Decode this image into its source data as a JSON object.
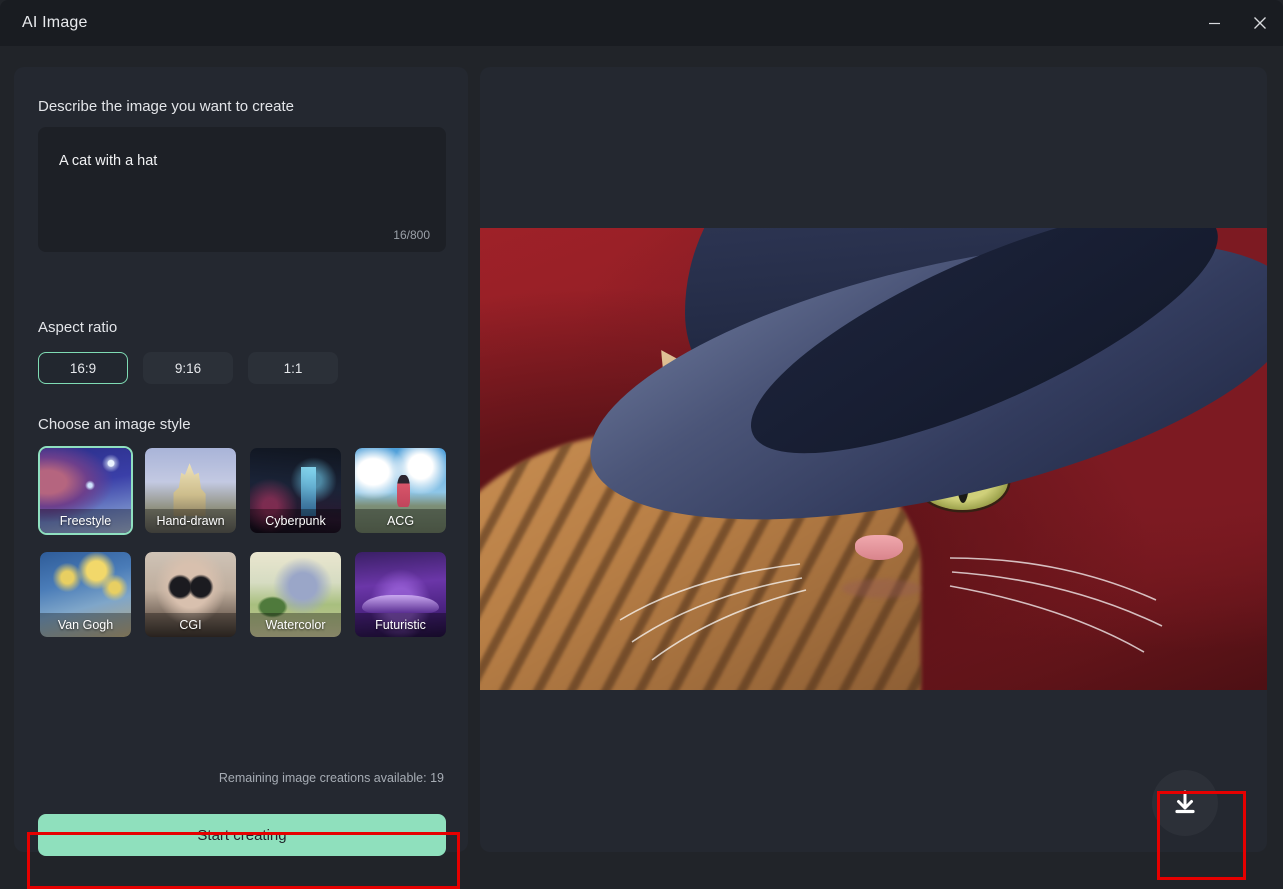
{
  "window": {
    "title": "AI Image",
    "controls": [
      {
        "name": "minimize",
        "glyph": "minimize-icon"
      },
      {
        "name": "close",
        "glyph": "close-icon"
      }
    ]
  },
  "left_panel": {
    "describe_label": "Describe the image you want to create",
    "prompt": {
      "value": "A cat with a hat",
      "placeholder": "Describe the image you want to create",
      "counter": "16/800",
      "char_count": 16,
      "char_limit": 800
    },
    "aspect_ratio": {
      "label": "Aspect ratio",
      "options": [
        {
          "label": "16:9",
          "selected": true
        },
        {
          "label": "9:16",
          "selected": false
        },
        {
          "label": "1:1",
          "selected": false
        }
      ]
    },
    "style": {
      "label": "Choose an image style",
      "options": [
        {
          "label": "Freestyle",
          "selected": true
        },
        {
          "label": "Hand-drawn",
          "selected": false
        },
        {
          "label": "Cyberpunk",
          "selected": false
        },
        {
          "label": "ACG",
          "selected": false
        },
        {
          "label": "Van Gogh",
          "selected": false
        },
        {
          "label": "CGI",
          "selected": false
        },
        {
          "label": "Watercolor",
          "selected": false
        },
        {
          "label": "Futuristic",
          "selected": false
        }
      ]
    },
    "remaining_text": "Remaining image creations available: 19",
    "remaining_count": 19,
    "start_button": "Start creating"
  },
  "right_panel": {
    "preview_alt": "Generated image: orange and white tabby cat wearing a dark navy cowboy hat against a red background",
    "download_icon": "download-icon"
  },
  "colors": {
    "accent_mint": "#8fe0bd",
    "selection_ring": "#8fe0c0",
    "annotation_red": "#e60000",
    "titlebar_bg": "#191c21",
    "panel_bg": "#242830",
    "window_bg": "#212429",
    "input_bg": "#1d2026"
  }
}
